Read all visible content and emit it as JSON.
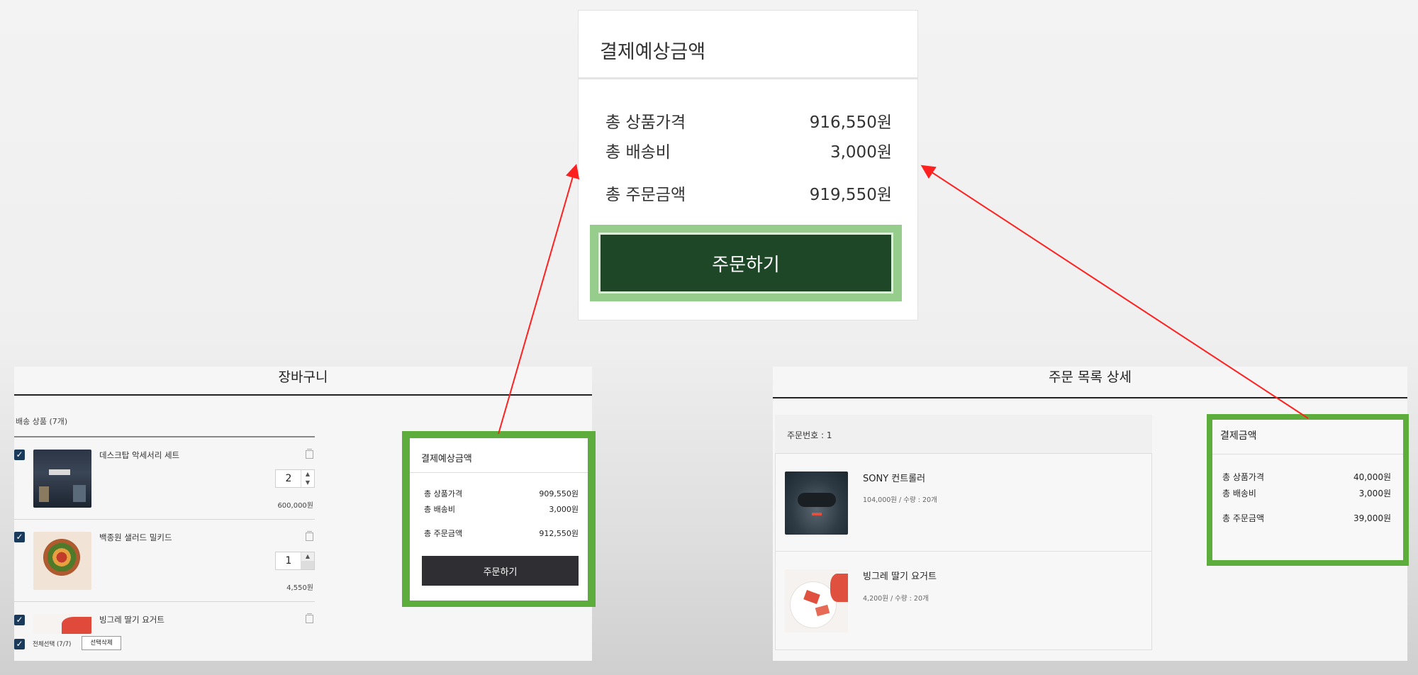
{
  "zoom": {
    "title": "결제예상금액",
    "rows": [
      {
        "label": "총 상품가격",
        "value": "916,550원"
      },
      {
        "label": "총 배송비",
        "value": "3,000원"
      },
      {
        "label": "총 주문금액",
        "value": "919,550원"
      }
    ],
    "order_button": "주문하기"
  },
  "cart": {
    "title": "장바구니",
    "section_label": "배송 상품 (7개)",
    "items": [
      {
        "name": "데스크탑 악세서리 세트",
        "qty": "2",
        "price": "600,000원"
      },
      {
        "name": "백종원 샐러드 밀키드",
        "qty": "1",
        "price": "4,550원"
      },
      {
        "name": "빙그레 딸기 요거트"
      }
    ],
    "select_all_label": "전체선택 (7/7)",
    "delete_selected": "선택삭제",
    "summary": {
      "title": "결제예상금액",
      "rows": [
        {
          "label": "총 상품가격",
          "value": "909,550원"
        },
        {
          "label": "총 배송비",
          "value": "3,000원"
        },
        {
          "label": "총 주문금액",
          "value": "912,550원"
        }
      ],
      "order_button": "주문하기"
    }
  },
  "order": {
    "title": "주문 목록 상세",
    "order_number": "주문번호 : 1",
    "items": [
      {
        "name": "SONY 컨트롤러",
        "meta": "104,000원 / 수량 : 20개"
      },
      {
        "name": "빙그레 딸기 요거트",
        "meta": "4,200원 / 수량 : 20개"
      }
    ],
    "summary": {
      "title": "결제금액",
      "rows": [
        {
          "label": "총 상품가격",
          "value": "40,000원"
        },
        {
          "label": "총 배송비",
          "value": "3,000원"
        },
        {
          "label": "총 주문금액",
          "value": "39,000원"
        }
      ]
    }
  },
  "colors": {
    "highlight_green": "#5dad3c",
    "zoom_button": "#1d4726",
    "cart_button": "#2f2f33",
    "arrow": "#ff2020",
    "checkbox": "#1a3a5c"
  }
}
